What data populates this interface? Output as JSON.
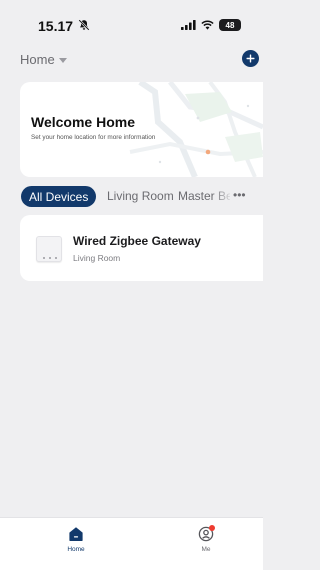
{
  "status_bar": {
    "time": "15.17",
    "battery": "48"
  },
  "header": {
    "home_selector_label": "Home"
  },
  "welcome": {
    "title": "Welcome Home",
    "subtitle": "Set your home location for more information"
  },
  "tabs": [
    {
      "label": "All Devices",
      "active": true
    },
    {
      "label": "Living Room",
      "active": false
    },
    {
      "label": "Master Bedroom",
      "active": false
    }
  ],
  "devices": [
    {
      "name": "Wired Zigbee Gateway",
      "room": "Living Room"
    }
  ],
  "bottom_nav": {
    "home_label": "Home",
    "me_label": "Me"
  },
  "colors": {
    "accent": "#12396b",
    "background": "#efeff1",
    "notification": "#ee3b30"
  },
  "icons": {
    "bell_off": "bell-slash-icon",
    "signal": "signal-bars-icon",
    "wifi": "wifi-icon",
    "battery": "battery-icon",
    "add": "plus-circle-icon",
    "home_nav": "home-icon",
    "me_nav": "user-circle-icon"
  }
}
